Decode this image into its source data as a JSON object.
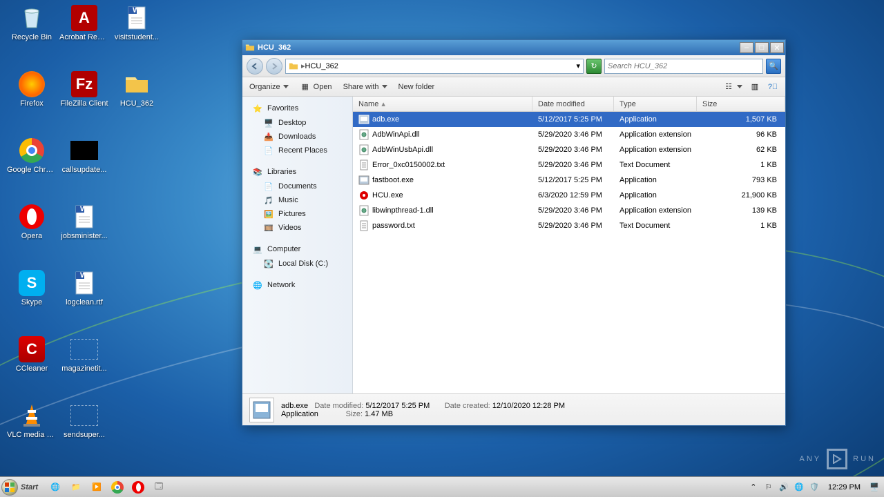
{
  "desktop_icons": [
    [
      {
        "name": "Recycle Bin",
        "kind": "bin"
      },
      {
        "name": "Acrobat Reader DC",
        "kind": "acrobat"
      },
      {
        "name": "visitstudent...",
        "kind": "doc"
      }
    ],
    [
      {
        "name": "Firefox",
        "kind": "firefox"
      },
      {
        "name": "FileZilla Client",
        "kind": "filezilla"
      },
      {
        "name": "HCU_362",
        "kind": "folder"
      }
    ],
    [
      {
        "name": "Google Chrome",
        "kind": "chrome"
      },
      {
        "name": "callsupdate...",
        "kind": "black"
      }
    ],
    [
      {
        "name": "Opera",
        "kind": "opera"
      },
      {
        "name": "jobsminister...",
        "kind": "doc"
      }
    ],
    [
      {
        "name": "Skype",
        "kind": "skype"
      },
      {
        "name": "logclean.rtf",
        "kind": "doc"
      }
    ],
    [
      {
        "name": "CCleaner",
        "kind": "ccleaner"
      },
      {
        "name": "magazinetit...",
        "kind": "blank"
      }
    ],
    [
      {
        "name": "VLC media player",
        "kind": "vlc"
      },
      {
        "name": "sendsuper...",
        "kind": "blank"
      }
    ]
  ],
  "window": {
    "title": "HCU_362",
    "path": "HCU_362",
    "search_placeholder": "Search HCU_362",
    "toolbar": {
      "organize": "Organize",
      "open": "Open",
      "share": "Share with",
      "new": "New folder"
    },
    "nav": {
      "favorites": "Favorites",
      "fav_items": [
        "Desktop",
        "Downloads",
        "Recent Places"
      ],
      "libraries": "Libraries",
      "lib_items": [
        "Documents",
        "Music",
        "Pictures",
        "Videos"
      ],
      "computer": "Computer",
      "comp_items": [
        "Local Disk (C:)"
      ],
      "network": "Network"
    },
    "cols": {
      "name": "Name",
      "date": "Date modified",
      "type": "Type",
      "size": "Size"
    },
    "files": [
      {
        "name": "adb.exe",
        "date": "5/12/2017 5:25 PM",
        "type": "Application",
        "size": "1,507 KB",
        "icon": "exe",
        "sel": true
      },
      {
        "name": "AdbWinApi.dll",
        "date": "5/29/2020 3:46 PM",
        "type": "Application extension",
        "size": "96 KB",
        "icon": "dll"
      },
      {
        "name": "AdbWinUsbApi.dll",
        "date": "5/29/2020 3:46 PM",
        "type": "Application extension",
        "size": "62 KB",
        "icon": "dll"
      },
      {
        "name": "Error_0xc0150002.txt",
        "date": "5/29/2020 3:46 PM",
        "type": "Text Document",
        "size": "1 KB",
        "icon": "txt"
      },
      {
        "name": "fastboot.exe",
        "date": "5/12/2017 5:25 PM",
        "type": "Application",
        "size": "793 KB",
        "icon": "exe"
      },
      {
        "name": "HCU.exe",
        "date": "6/3/2020 12:59 PM",
        "type": "Application",
        "size": "21,900 KB",
        "icon": "hcu"
      },
      {
        "name": "libwinpthread-1.dll",
        "date": "5/29/2020 3:46 PM",
        "type": "Application extension",
        "size": "139 KB",
        "icon": "dll"
      },
      {
        "name": "password.txt",
        "date": "5/29/2020 3:46 PM",
        "type": "Text Document",
        "size": "1 KB",
        "icon": "txt"
      }
    ],
    "details": {
      "name": "adb.exe",
      "type": "Application",
      "modified_label": "Date modified:",
      "modified": "5/12/2017 5:25 PM",
      "created_label": "Date created:",
      "created": "12/10/2020 12:28 PM",
      "size_label": "Size:",
      "size": "1.47 MB"
    }
  },
  "taskbar": {
    "start": "Start",
    "clock": "12:29 PM"
  },
  "watermark": {
    "t1": "ANY",
    "t2": "RUN"
  }
}
